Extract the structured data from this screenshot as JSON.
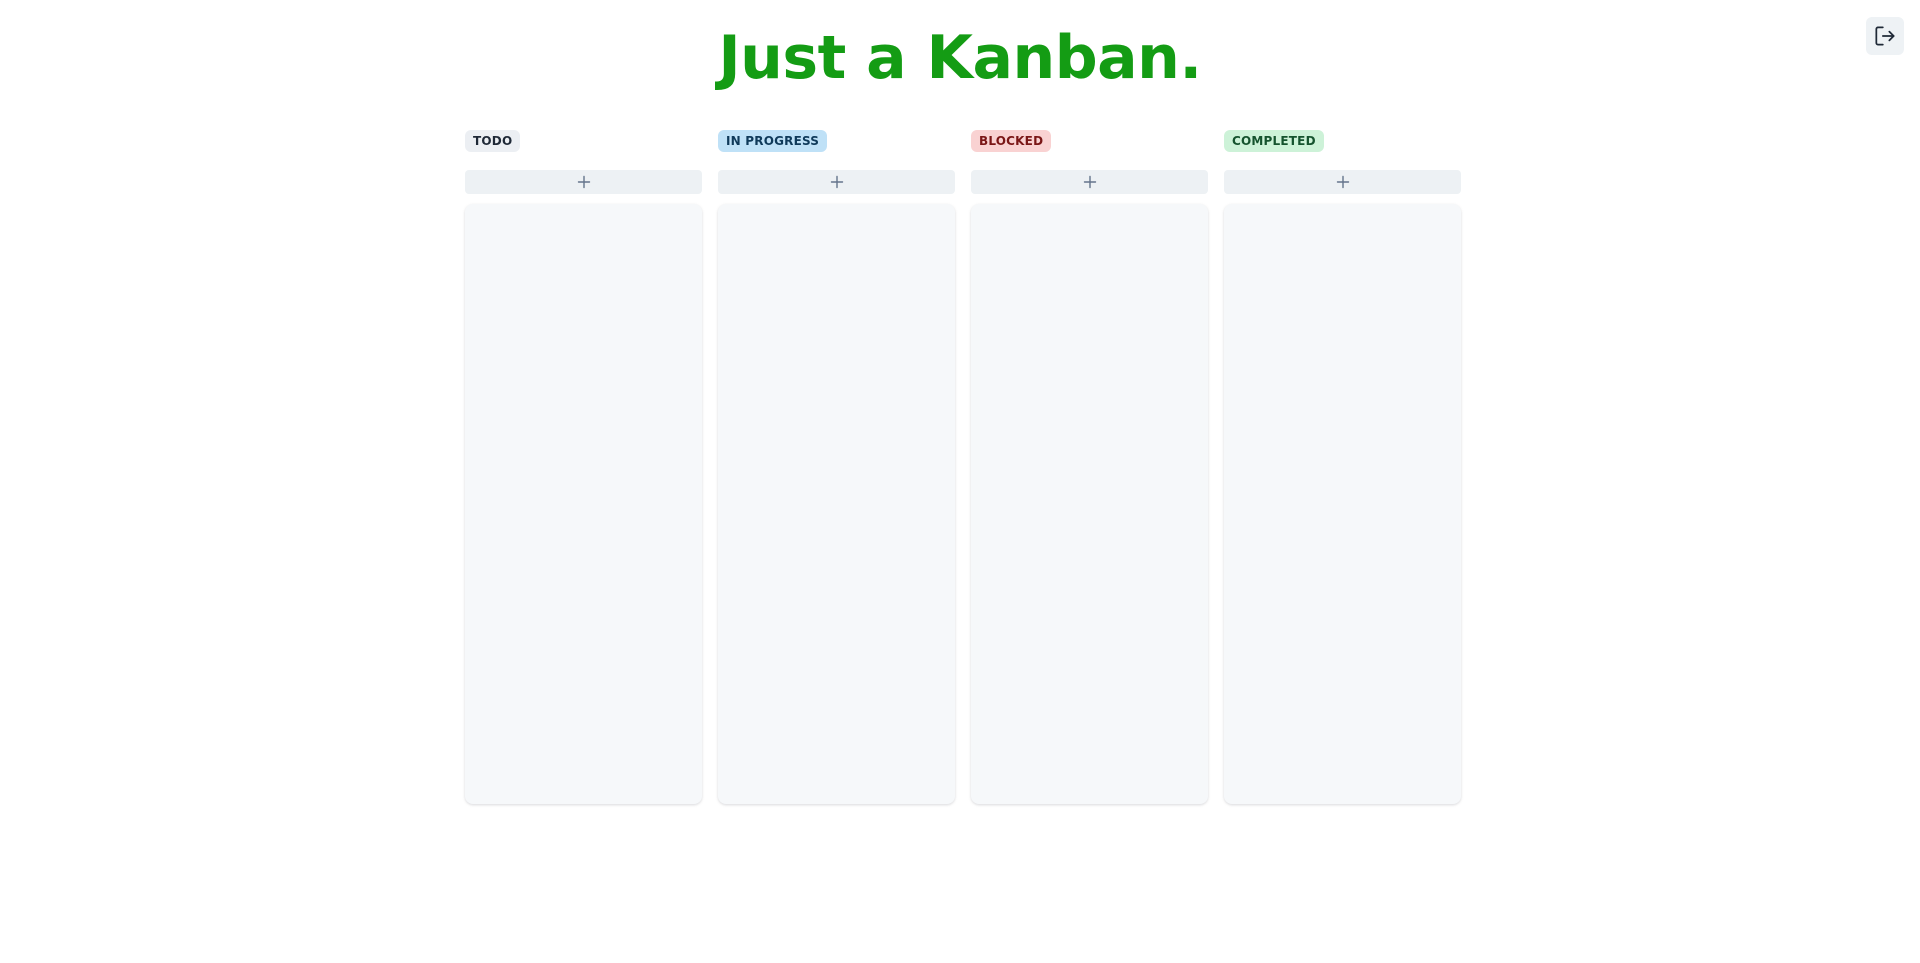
{
  "header": {
    "title": "Just a Kanban.",
    "title_color": "#149c14",
    "logout_icon": "logout-icon",
    "logout_button_bg": "#eef2f5"
  },
  "board": {
    "add_icon": "plus-icon",
    "add_button_bg": "#edf1f4",
    "add_icon_color": "#64748b",
    "list_bg": "#f6f8fa",
    "columns": [
      {
        "id": "todo",
        "label": "TODO",
        "badge_bg": "#eceff3",
        "badge_color": "#1f2937",
        "cards": []
      },
      {
        "id": "in-progress",
        "label": "IN PROGRESS",
        "badge_bg": "#bfe1f7",
        "badge_color": "#0f3a5a",
        "cards": []
      },
      {
        "id": "blocked",
        "label": "BLOCKED",
        "badge_bg": "#f9d2d2",
        "badge_color": "#7a1616",
        "cards": []
      },
      {
        "id": "completed",
        "label": "COMPLETED",
        "badge_bg": "#cdf2d8",
        "badge_color": "#15532e",
        "cards": []
      }
    ]
  }
}
